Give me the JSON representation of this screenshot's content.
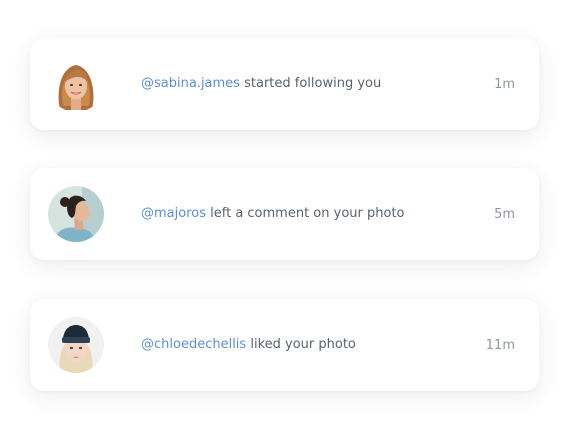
{
  "notifications": [
    {
      "handle": "@sabina.james",
      "text": "started following you",
      "time": "1m",
      "avatar_icon": "woman-blonde-avatar"
    },
    {
      "handle": "@majoros",
      "text": "left a comment on your photo",
      "time": "5m",
      "avatar_icon": "woman-profile-avatar"
    },
    {
      "handle": "@chloedechellis",
      "text": "liked your photo",
      "time": "11m",
      "avatar_icon": "woman-beanie-avatar"
    }
  ],
  "colors": {
    "handle": "#5b8ed8",
    "text": "#5a6270",
    "time": "#8f96a0",
    "card_bg": "#ffffff"
  }
}
